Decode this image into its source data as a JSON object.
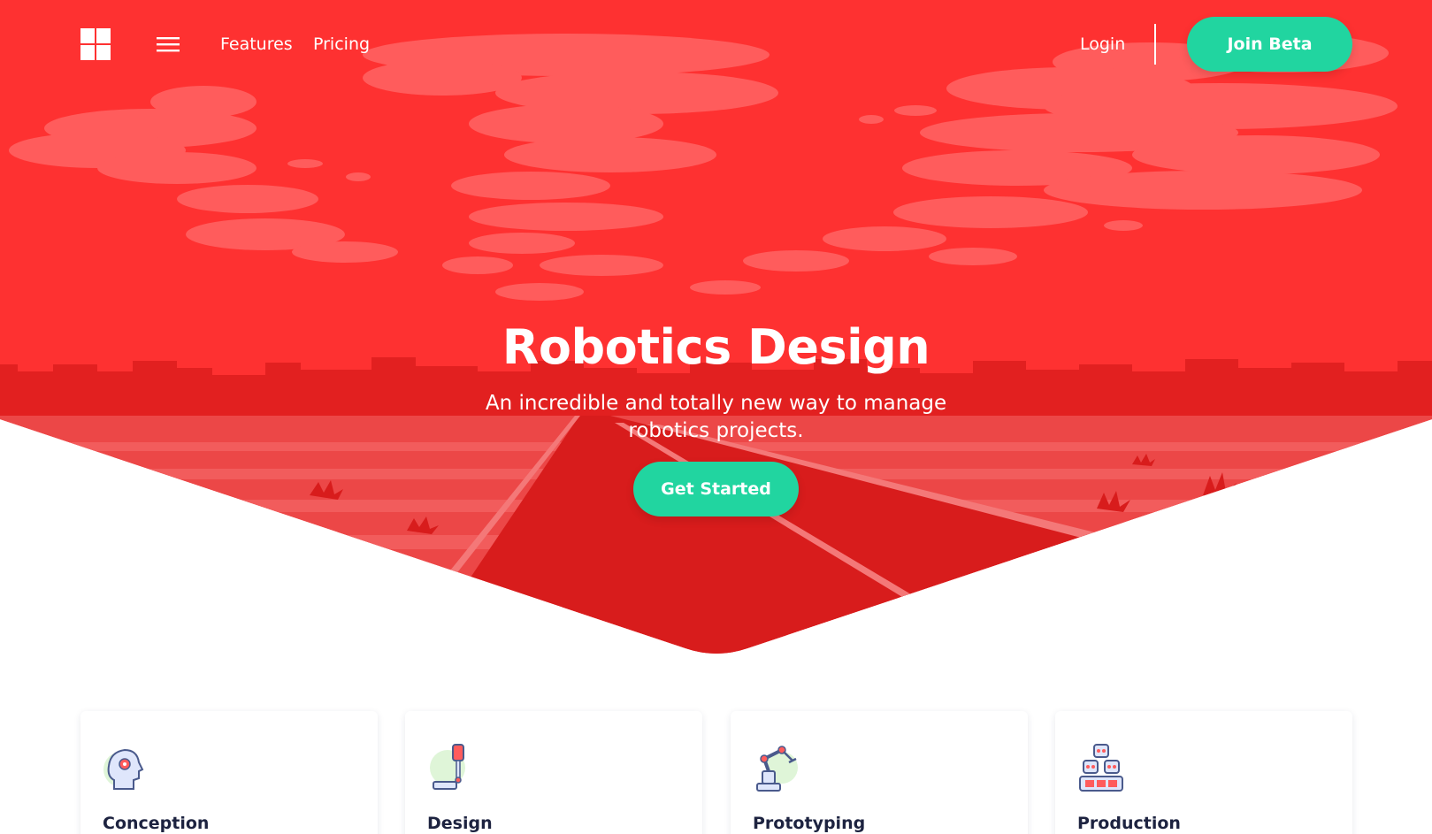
{
  "colors": {
    "hero_red": "#fe3131",
    "accent_green": "#21d5a0",
    "title_dark": "#1d2340"
  },
  "nav": {
    "logo_icon": "windows-grid-icon",
    "menu_icon": "hamburger-icon",
    "features_label": "Features",
    "pricing_label": "Pricing",
    "login_label": "Login",
    "join_beta_label": "Join Beta"
  },
  "hero": {
    "title": "Robotics Design",
    "subtitle": "An incredible and totally new way to manage robotics projects.",
    "cta_label": "Get Started"
  },
  "features": [
    {
      "title": "Conception",
      "icon": "head-gear-icon"
    },
    {
      "title": "Design",
      "icon": "robot-arm-pen-icon"
    },
    {
      "title": "Prototyping",
      "icon": "robotic-arm-icon"
    },
    {
      "title": "Production",
      "icon": "robot-stack-icon"
    }
  ]
}
